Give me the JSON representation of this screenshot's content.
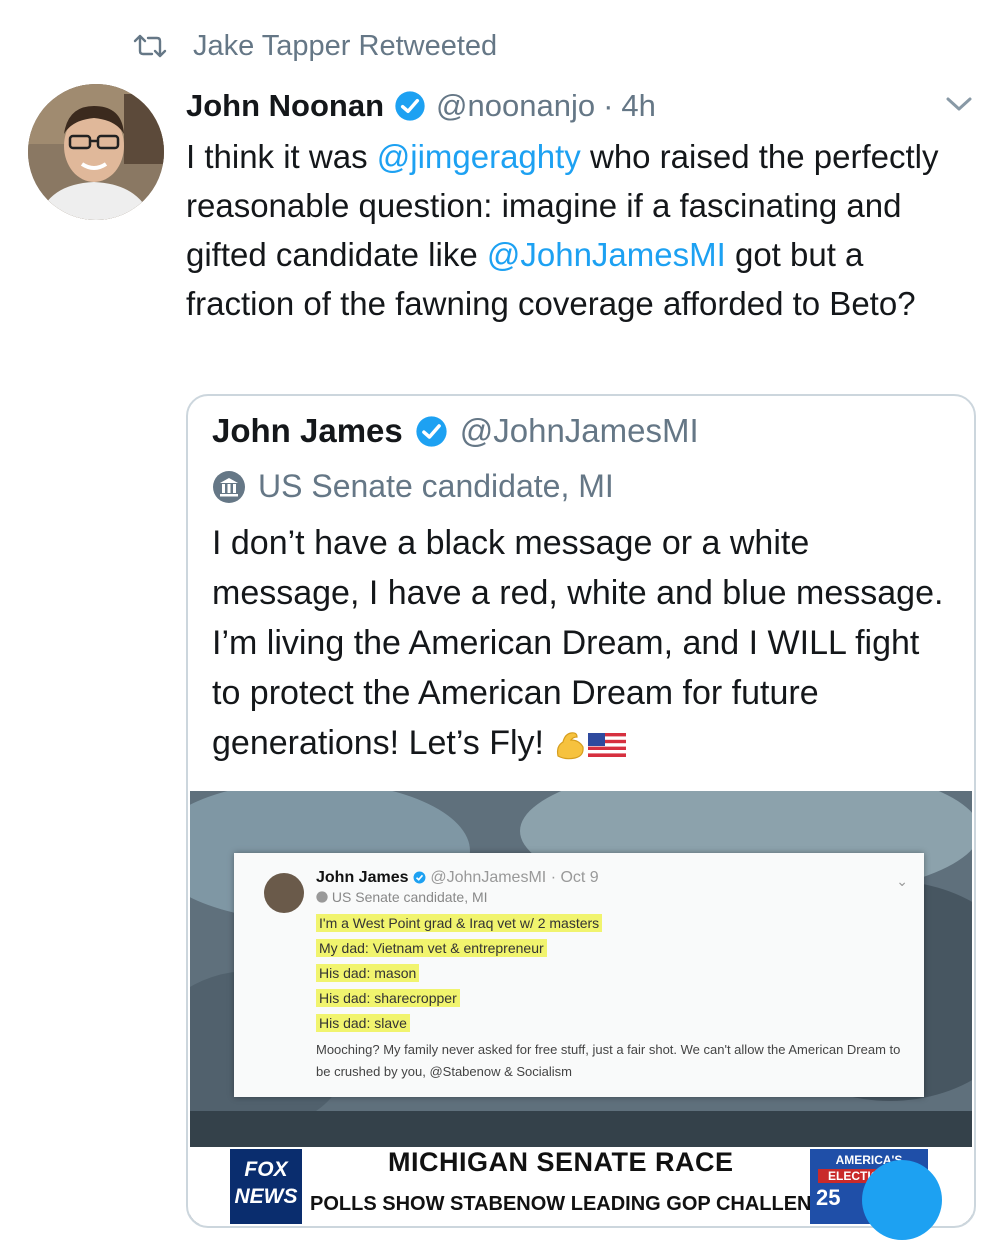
{
  "retweet": {
    "label": "Jake Tapper Retweeted"
  },
  "tweet": {
    "author_name": "John Noonan",
    "handle": "@noonanjo",
    "separator": "·",
    "time": "4h",
    "text_part1": "I think it was ",
    "mention1": "@jimgeraghty",
    "text_part2": " who raised the perfectly reasonable question: imagine if a fascinating and gifted candidate like ",
    "mention2": "@JohnJamesMI",
    "text_part3": " got but a fraction of the fawning coverage afforded to Beto?"
  },
  "quote": {
    "author_name": "John James",
    "handle": "@JohnJamesMI",
    "label": "US Senate candidate, MI",
    "text": "I don’t have a black message or a white message, I have a red, white and blue message. I’m living the American Dream, and I WILL fight to protect the American Dream for future generations! Let’s Fly! "
  },
  "media": {
    "embed": {
      "name": "John James",
      "handle": "@JohnJamesMI",
      "separator": "·",
      "date": "Oct 9",
      "label": "US Senate candidate, MI",
      "lines": [
        "I'm a West Point grad & Iraq vet w/ 2 masters",
        "My dad: Vietnam vet & entrepreneur",
        "His dad: mason",
        "His dad: sharecropper",
        "His dad: slave"
      ],
      "tail": "Mooching? My family never asked for free stuff, just a fair shot. We can't allow the American Dream to be crushed by you, @Stabenow & Socialism"
    },
    "banner": {
      "network_line1": "FOX",
      "network_line2": "NEWS",
      "headline": "MICHIGAN SENATE RACE",
      "subhead": "POLLS SHOW STABENOW LEADING GOP CHALLENGER",
      "show_line1": "AMERICA'S",
      "show_line2": "ELECTION HQ",
      "show_number": "25"
    }
  },
  "colors": {
    "link": "#1da1f2",
    "secondary_text": "#657786",
    "highlight": "#f1f46e"
  }
}
